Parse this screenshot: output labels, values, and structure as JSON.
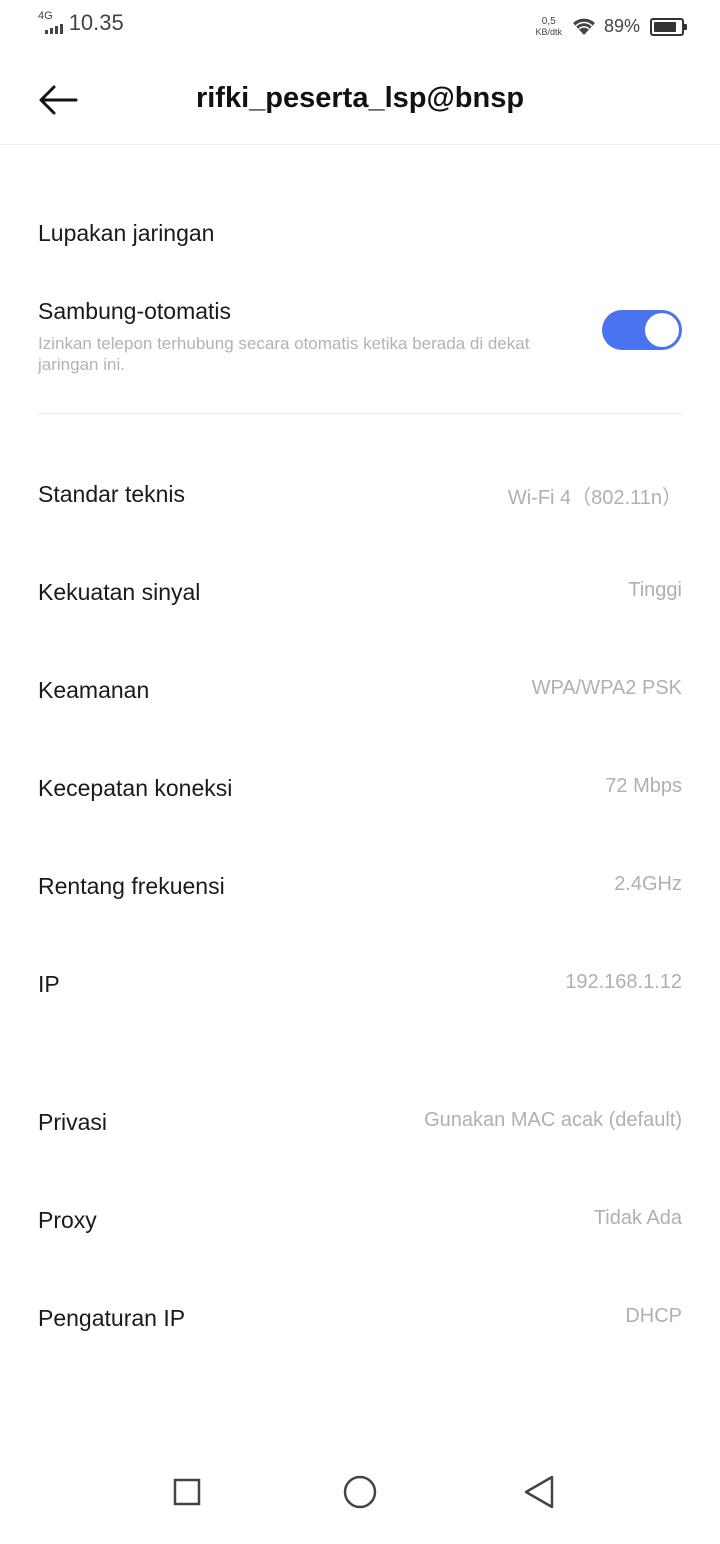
{
  "status_bar": {
    "network": "4G",
    "time": "10.35",
    "speed_value": "0,5",
    "speed_unit": "KB/dtk",
    "battery": "89%"
  },
  "header": {
    "title": "rifki_peserta_lsp@bnsp"
  },
  "actions": {
    "forget_network": "Lupakan jaringan",
    "auto_connect": {
      "label": "Sambung-otomatis",
      "description": "Izinkan telepon terhubung secara otomatis ketika berada di dekat jaringan ini.",
      "enabled": true
    }
  },
  "details": [
    {
      "label": "Standar teknis",
      "value": "Wi-Fi 4（802.11n）"
    },
    {
      "label": "Kekuatan sinyal",
      "value": "Tinggi"
    },
    {
      "label": "Keamanan",
      "value": "WPA/WPA2 PSK"
    },
    {
      "label": "Kecepatan koneksi",
      "value": "72 Mbps"
    },
    {
      "label": "Rentang frekuensi",
      "value": "2.4GHz"
    },
    {
      "label": "IP",
      "value": "192.168.1.12"
    }
  ],
  "settings": [
    {
      "label": "Privasi",
      "value": "Gunakan MAC acak (default)"
    },
    {
      "label": "Proxy",
      "value": "Tidak Ada"
    },
    {
      "label": "Pengaturan IP",
      "value": "DHCP"
    }
  ],
  "colors": {
    "accent": "#4a73f0",
    "value_text": "#b0b0b0"
  }
}
